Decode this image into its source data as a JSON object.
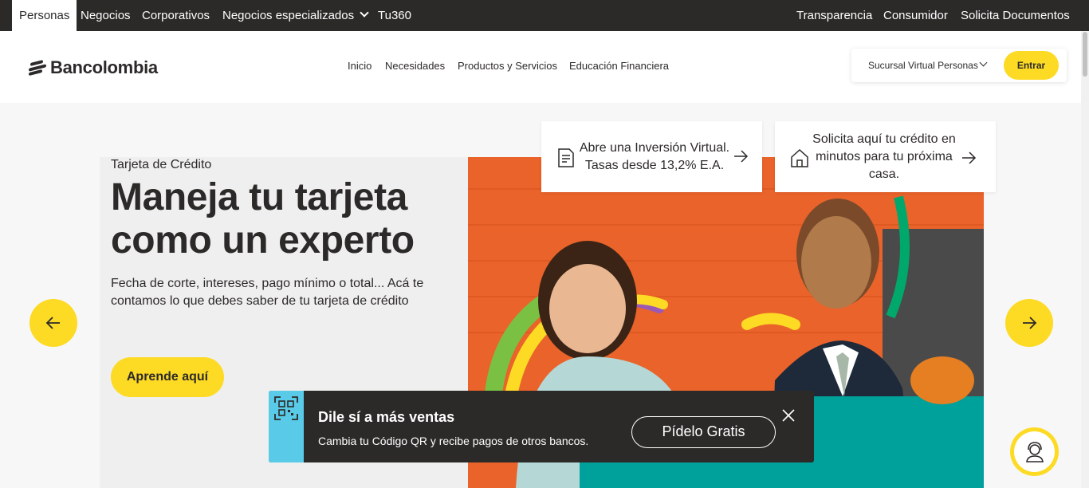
{
  "topbar": {
    "segments": [
      {
        "label": "Personas",
        "active": true
      },
      {
        "label": "Negocios"
      },
      {
        "label": "Corporativos"
      },
      {
        "label": "Negocios especializados",
        "has_dropdown": true
      },
      {
        "label": "Tu360"
      }
    ],
    "right_links": [
      "Transparencia",
      "Consumidor",
      "Solicita Documentos"
    ]
  },
  "header": {
    "logo_text": "Bancolombia",
    "nav": [
      "Inicio",
      "Necesidades",
      "Productos y Servicios",
      "Educación Financiera"
    ],
    "sucursal_label": "Sucursal Virtual Personas",
    "entrar_label": "Entrar"
  },
  "hero": {
    "eyebrow": "Tarjeta de Crédito",
    "title_line1": "Maneja tu tarjeta",
    "title_line2": "como un experto",
    "description": "Fecha de corte, intereses, pago mínimo o total... Acá te contamos lo que debes saber de tu tarjeta de crédito",
    "cta_label": "Aprende aquí"
  },
  "cards": [
    {
      "line1": "Abre una Inversión Virtual.",
      "line2": "Tasas desde 13,2% E.A.",
      "icon": "document-icon"
    },
    {
      "line1": "Solicita aquí tu crédito en",
      "line2": "minutos para tu próxima",
      "line3": "casa.",
      "icon": "house-icon"
    }
  ],
  "banner": {
    "title": "Dile sí a más ventas",
    "subtitle": "Cambia tu Código QR y recibe pagos de otros bancos.",
    "cta_label": "Pídelo Gratis",
    "icon": "qr-code-icon"
  },
  "colors": {
    "brand_yellow": "#fdda24",
    "dark": "#2c2a29",
    "banner_accent": "#59cbe8",
    "hero_orange": "#e9632a"
  }
}
